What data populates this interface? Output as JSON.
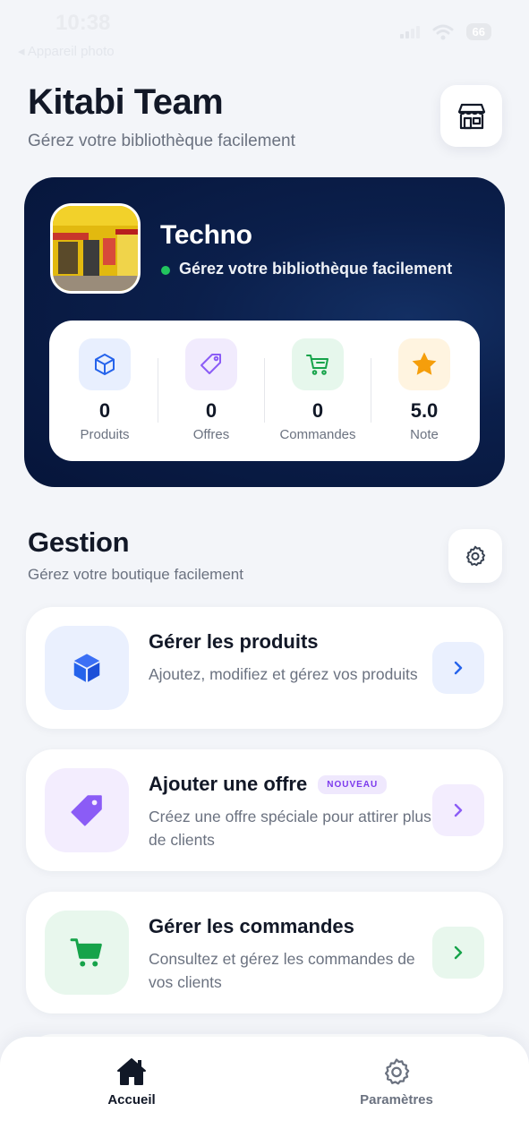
{
  "status_bar": {
    "time": "10:38",
    "back_label": "◂ Appareil photo",
    "battery": "66"
  },
  "header": {
    "title": "Kitabi Team",
    "subtitle": "Gérez votre bibliothèque facilement",
    "shop_icon": "store-icon"
  },
  "profile": {
    "name": "Techno",
    "status_text": "Gérez votre bibliothèque facilement",
    "status_color": "#22c55e",
    "stats": [
      {
        "value": "0",
        "label": "Produits",
        "icon": "box-icon",
        "color": "#2563eb"
      },
      {
        "value": "0",
        "label": "Offres",
        "icon": "tag-icon",
        "color": "#8b5cf6"
      },
      {
        "value": "0",
        "label": "Commandes",
        "icon": "cart-icon",
        "color": "#16a34a"
      },
      {
        "value": "5.0",
        "label": "Note",
        "icon": "star-icon",
        "color": "#f59e0b"
      }
    ]
  },
  "section": {
    "title": "Gestion",
    "subtitle": "Gérez votre boutique facilement"
  },
  "actions": [
    {
      "title": "Gérer les produits",
      "description": "Ajoutez, modifiez et gérez vos produits",
      "icon": "box-icon",
      "color": "#2563eb"
    },
    {
      "title": "Ajouter une offre",
      "badge": "NOUVEAU",
      "description": "Créez une offre spéciale pour attirer plus de clients",
      "icon": "tag-icon",
      "color": "#8b5cf6"
    },
    {
      "title": "Gérer les commandes",
      "description": "Consultez et gérez les commandes de vos clients",
      "icon": "cart-icon",
      "color": "#16a34a"
    }
  ],
  "nav": [
    {
      "label": "Accueil",
      "icon": "home-icon",
      "active": true
    },
    {
      "label": "Paramètres",
      "icon": "gear-icon",
      "active": false
    }
  ],
  "colors": {
    "primary_dark": "#0b1f4b",
    "background": "#f3f5f9"
  }
}
